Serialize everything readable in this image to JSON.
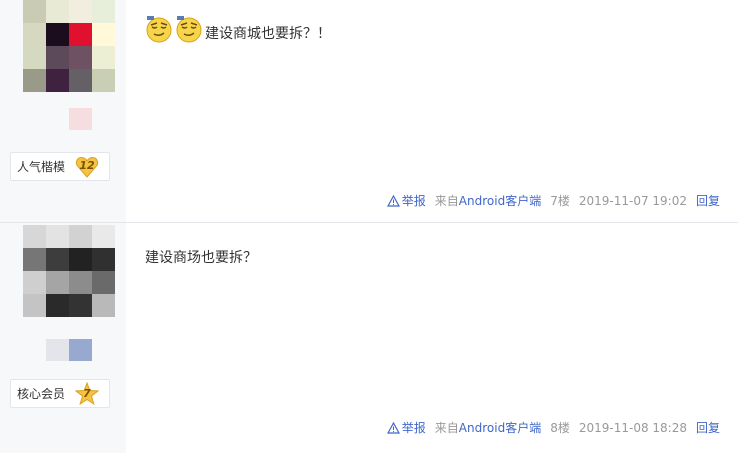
{
  "posts": [
    {
      "content_text": "建设商城也要拆？！",
      "has_emojis": true,
      "badge_label": "人气楷模",
      "level": "12",
      "report": "举报",
      "source_prefix": "来自",
      "source_app": "Android客户端",
      "floor": "7楼",
      "time": "2019-11-07 19:02",
      "reply": "回复"
    },
    {
      "content_text": "建设商场也要拆？",
      "has_emojis": false,
      "badge_label": "核心会员",
      "level": "7",
      "report": "举报",
      "source_prefix": "来自",
      "source_app": "Android客户端",
      "floor": "8楼",
      "time": "2019-11-08 18:28",
      "reply": "回复"
    }
  ],
  "colors": {
    "link": "#3f66c9",
    "meta": "#999999",
    "sidebar": "#f7f8fa",
    "badge_gold": "#f5c242"
  },
  "icons": {
    "emoji": "smug-face-emoji-icon",
    "report": "warning-triangle-icon",
    "level": "heart-level-icon"
  }
}
